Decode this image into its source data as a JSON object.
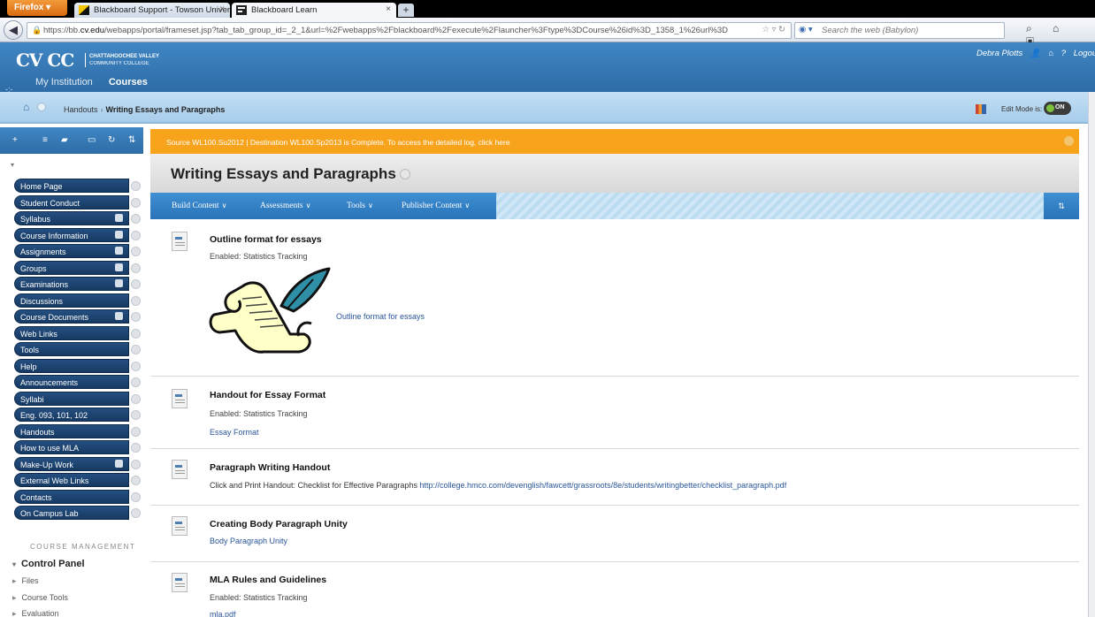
{
  "browser": {
    "menu_label": "Firefox",
    "tabs": [
      {
        "title": "Blackboard Support - Towson Univer...",
        "close": "×"
      },
      {
        "title": "Blackboard Learn",
        "close": "×"
      }
    ],
    "new_tab": "+",
    "url_prefix": "https://bb.",
    "url_domain": "cv.edu",
    "url_rest": "/webapps/portal/frameset.jsp?tab_tab_group_id=_2_1&url=%2Fwebapps%2Fblackboard%2Fexecute%2Flauncher%3Ftype%3DCourse%26id%3D_1358_1%26url%3D",
    "search_placeholder": "Search the web (Babylon)"
  },
  "header": {
    "logo_text": "CV CC",
    "college_name": "CHATTAHOOCHEE VALLEY",
    "college_sub": "COMMUNITY COLLEGE",
    "user": "Debra Plotts",
    "logout": "Logout",
    "tabs": [
      "My Institution",
      "Courses"
    ]
  },
  "breadcrumb": {
    "parent": "Handouts",
    "current": "Writing Essays and Paragraphs",
    "edit_mode_label": "Edit Mode is:",
    "edit_mode_value": "ON"
  },
  "menu": [
    {
      "label": "Home Page",
      "icon": false
    },
    {
      "label": "Student Conduct",
      "icon": false
    },
    {
      "label": "Syllabus",
      "icon": true
    },
    {
      "label": "Course Information",
      "icon": true
    },
    {
      "label": "Assignments",
      "icon": true
    },
    {
      "label": "Groups",
      "icon": true
    },
    {
      "label": "Examinations",
      "icon": true
    },
    {
      "label": "Discussions",
      "icon": false
    },
    {
      "label": "Course Documents",
      "icon": true
    },
    {
      "label": "Web Links",
      "icon": false
    },
    {
      "label": "Tools",
      "icon": false
    },
    {
      "label": "Help",
      "icon": false
    },
    {
      "label": "Announcements",
      "icon": false
    },
    {
      "label": "Syllabi",
      "icon": false
    },
    {
      "label": "Eng. 093, 101, 102",
      "icon": false
    },
    {
      "label": "Handouts",
      "icon": false
    },
    {
      "label": "How to use MLA",
      "icon": false
    },
    {
      "label": "Make-Up Work",
      "icon": true
    },
    {
      "label": "External Web Links",
      "icon": false
    },
    {
      "label": "Contacts",
      "icon": false
    },
    {
      "label": "On Campus Lab",
      "icon": false
    }
  ],
  "course_management": {
    "heading": "COURSE MANAGEMENT",
    "control_panel": "Control Panel",
    "items": [
      "Files",
      "Course Tools",
      "Evaluation"
    ]
  },
  "alert": {
    "text": "Source WL100.Su2012 | Destination WL100.Sp2013 is Complete. To access the detailed log, click",
    "link": "here"
  },
  "page_title": "Writing Essays and Paragraphs",
  "action_bar": [
    "Build Content",
    "Assessments",
    "Tools",
    "Publisher Content"
  ],
  "items": [
    {
      "title": "Outline format for essays",
      "meta": "Enabled:  Statistics Tracking",
      "link": "Outline format for essays"
    },
    {
      "title": "Handout for Essay Format",
      "meta": "Enabled:  Statistics Tracking",
      "link": "Essay Format"
    },
    {
      "title": "Paragraph Writing Handout",
      "text": "Click and Print Handout: Checklist for Effective Paragraphs",
      "link": "http://college.hmco.com/devenglish/fawcett/grassroots/8e/students/writingbetter/checklist_paragraph.pdf"
    },
    {
      "title": "Creating Body Paragraph Unity",
      "link": "Body Paragraph Unity"
    },
    {
      "title": "MLA Rules and Guidelines",
      "meta": "Enabled:  Statistics Tracking",
      "link": "mla.pdf"
    }
  ]
}
